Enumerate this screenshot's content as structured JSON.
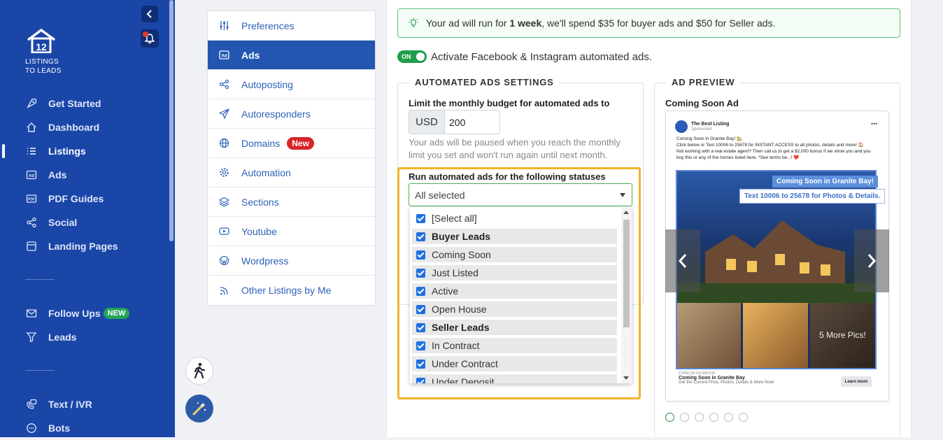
{
  "app": {
    "logo_number": "12",
    "logo_line1": "LISTINGS",
    "logo_line2": "TO LEADS"
  },
  "sidebar": {
    "items": [
      {
        "label": "Get Started",
        "icon": "rocket-icon"
      },
      {
        "label": "Dashboard",
        "icon": "home-icon"
      },
      {
        "label": "Listings",
        "icon": "list-icon",
        "active": true
      },
      {
        "label": "Ads",
        "icon": "ad-icon"
      },
      {
        "label": "PDF Guides",
        "icon": "pdf-icon"
      },
      {
        "label": "Social",
        "icon": "share-icon"
      },
      {
        "label": "Landing Pages",
        "icon": "page-icon"
      }
    ],
    "items2": [
      {
        "label": "Follow Ups",
        "icon": "mail-icon",
        "badge": "NEW"
      },
      {
        "label": "Leads",
        "icon": "filter-icon"
      }
    ],
    "items3": [
      {
        "label": "Text / IVR",
        "icon": "phone-icon"
      },
      {
        "label": "Bots",
        "icon": "chat-icon"
      }
    ]
  },
  "submenu": {
    "items": [
      {
        "label": "Preferences"
      },
      {
        "label": "Ads",
        "active": true
      },
      {
        "label": "Autoposting"
      },
      {
        "label": "Autoresponders"
      },
      {
        "label": "Domains",
        "badge": "New"
      },
      {
        "label": "Automation"
      },
      {
        "label": "Sections"
      },
      {
        "label": "Youtube"
      },
      {
        "label": "Wordpress"
      },
      {
        "label": "Other Listings by Me"
      }
    ]
  },
  "info": {
    "prefix": "Your ad will run for ",
    "duration": "1 week",
    "suffix": ", we'll spend $35 for buyer ads and $50 for Seller ads."
  },
  "toggle": {
    "state": "ON",
    "label": "Activate Facebook & Instagram automated ads."
  },
  "settings": {
    "legend": "AUTOMATED ADS SETTINGS",
    "budget_label": "Limit the monthly budget for automated ads to",
    "currency": "USD",
    "budget_value": "200",
    "help": "Your ads will be paused when you reach the monthly limit you set and won't run again until next month.",
    "statuses_label": "Run automated ads for the following statuses",
    "select_value": "All selected",
    "options": [
      {
        "label": "[Select all]",
        "group": false,
        "shaded": false
      },
      {
        "label": "Buyer Leads",
        "group": true,
        "shaded": true
      },
      {
        "label": "Coming Soon",
        "group": false,
        "shaded": true
      },
      {
        "label": "Just Listed",
        "group": false,
        "shaded": true
      },
      {
        "label": "Active",
        "group": false,
        "shaded": true
      },
      {
        "label": "Open House",
        "group": false,
        "shaded": true
      },
      {
        "label": "Seller Leads",
        "group": true,
        "shaded": true
      },
      {
        "label": "In Contract",
        "group": false,
        "shaded": true
      },
      {
        "label": "Under Contract",
        "group": false,
        "shaded": true
      },
      {
        "label": "Under Deposit",
        "group": false,
        "shaded": true
      }
    ]
  },
  "preview": {
    "legend": "AD PREVIEW",
    "title": "Coming Soon Ad",
    "page_name": "The Best Listing",
    "sponsored": "Sponsored",
    "text_line1": "Coming Soon in Granite Bay! 🏡",
    "text_line2": "Click below or Text 10006 to 25678 for INSTANT ACCESS to all photos, details and more! 🏠",
    "text_line3": "Not working with a real estate agent? Then call us to get a $2,000 bonus if we show you and you buy this or any of the homes listed here. *See terms be...! ❤️",
    "tag1": "Coming Soon in Granite Bay!",
    "tag2": "Text 10006 to 25678 for Photos & Details.",
    "more_pics": "5 More Pics!",
    "footer_source": "FORM ON FACEBOOK",
    "footer_title": "Coming Soon in Granite Bay",
    "footer_sub": "Get the Current Price, Photos, Details & More Now!",
    "cta": "Learn more",
    "dots": 6,
    "active_dot": 0
  },
  "colors": {
    "sidebar": "#1a46a8",
    "accent": "#2356b0",
    "success": "#1e9e4a",
    "highlight": "#f0b429"
  }
}
